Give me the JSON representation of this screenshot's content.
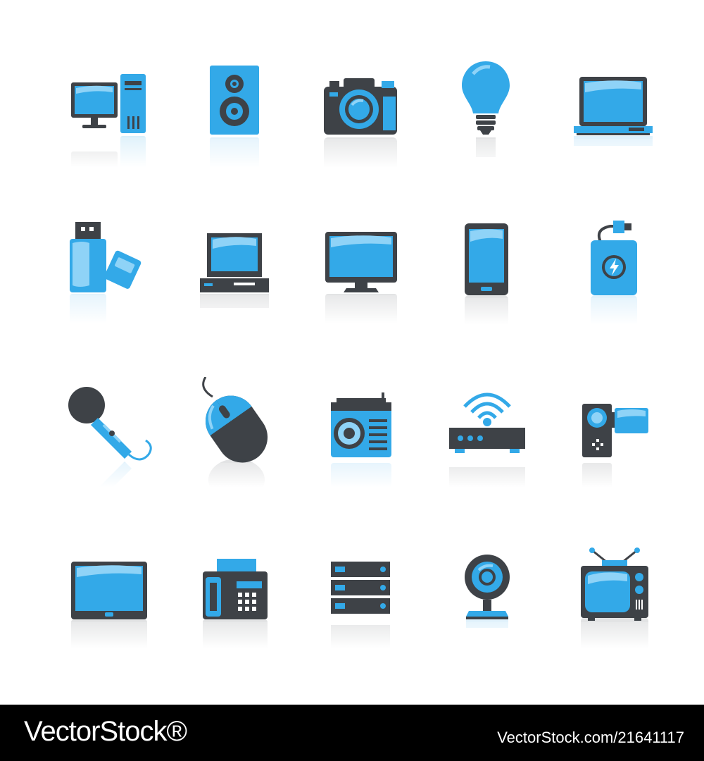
{
  "colors": {
    "blue": "#33A9E8",
    "blue_light": "#8FD3F7",
    "dark": "#3E4247",
    "background": "#FFFFFF",
    "footer": "#000000"
  },
  "icons": [
    "desktop-computer-icon",
    "speaker-icon",
    "photo-camera-icon",
    "light-bulb-icon",
    "laptop-icon",
    "usb-flash-drive-icon",
    "retro-computer-icon",
    "monitor-icon",
    "smartphone-icon",
    "power-bank-icon",
    "microphone-icon",
    "computer-mouse-icon",
    "radio-icon",
    "wifi-router-icon",
    "camcorder-icon",
    "tablet-icon",
    "fax-machine-icon",
    "server-rack-icon",
    "webcam-icon",
    "television-icon"
  ],
  "footer": {
    "brand": "VectorStock®",
    "stock_id": "VectorStock.com/21641117"
  }
}
